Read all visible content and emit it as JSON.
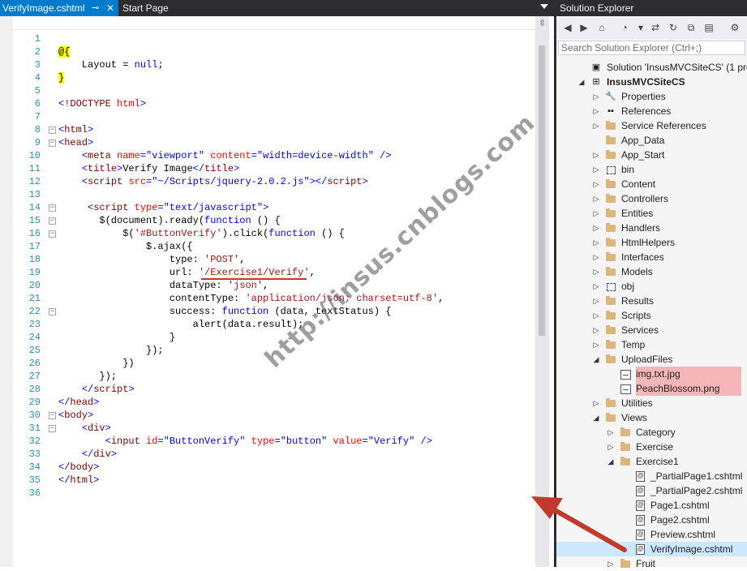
{
  "tabs": {
    "active": "VerifyImage.cshtml",
    "other": "Start Page"
  },
  "editor": {
    "lines": [
      {
        "n": "1",
        "html": ""
      },
      {
        "n": "2",
        "html": "<span class='rz'>@{</span>"
      },
      {
        "n": "3",
        "html": "    Layout = <span class='kw'>null</span>;"
      },
      {
        "n": "4",
        "html": "<span class='rz'>}</span>"
      },
      {
        "n": "5",
        "html": ""
      },
      {
        "n": "6",
        "html": "<span class='kw'>&lt;</span><span class='tg'>!DOCTYPE</span> <span class='at'>html</span><span class='kw'>&gt;</span>"
      },
      {
        "n": "7",
        "html": ""
      },
      {
        "n": "8",
        "html": "<span class='kw'>&lt;</span><span class='tg'>html</span><span class='kw'>&gt;</span>",
        "fold": true
      },
      {
        "n": "9",
        "html": "<span class='kw'>&lt;</span><span class='tg'>head</span><span class='kw'>&gt;</span>",
        "fold": true
      },
      {
        "n": "10",
        "html": "    <span class='kw'>&lt;</span><span class='tg'>meta</span> <span class='at'>name</span><span class='kw'>=</span><span class='kw'>\"viewport\"</span> <span class='at'>content</span><span class='kw'>=</span><span class='kw'>\"width=device-width\"</span> <span class='kw'>/&gt;</span>"
      },
      {
        "n": "11",
        "html": "    <span class='kw'>&lt;</span><span class='tg'>title</span><span class='kw'>&gt;</span>Verify Image<span class='kw'>&lt;/</span><span class='tg'>title</span><span class='kw'>&gt;</span>"
      },
      {
        "n": "12",
        "html": "    <span class='kw'>&lt;</span><span class='tg'>script</span> <span class='at'>src</span><span class='kw'>=</span><span class='kw'>\"~/Scripts/jquery-2.0.2.js\"</span><span class='kw'>&gt;&lt;/</span><span class='tg'>script</span><span class='kw'>&gt;</span>"
      },
      {
        "n": "13",
        "html": ""
      },
      {
        "n": "14",
        "html": "     <span class='kw'>&lt;</span><span class='tg'>script</span> <span class='at'>type</span><span class='kw'>=</span><span class='kw'>\"text/javascript\"</span><span class='kw'>&gt;</span>",
        "fold": true
      },
      {
        "n": "15",
        "html": "       $(document).ready(<span class='kw'>function</span> () {",
        "fold": true
      },
      {
        "n": "16",
        "html": "           $(<span class='st'>'#ButtonVerify'</span>).click(<span class='kw'>function</span> () {",
        "fold": true
      },
      {
        "n": "17",
        "html": "               $.ajax({"
      },
      {
        "n": "18",
        "html": "                   type: <span class='st'>'POST'</span>,"
      },
      {
        "n": "19",
        "html": "                   url: <span class='st'>'/Exercise1/Verify'</span>,"
      },
      {
        "n": "20",
        "html": "                   dataType: <span class='st'>'json'</span>,"
      },
      {
        "n": "21",
        "html": "                   contentType: <span class='st'>'application/json; charset=utf-8'</span>,"
      },
      {
        "n": "22",
        "html": "                   success: <span class='kw'>function</span> (data, textStatus) {",
        "fold": true
      },
      {
        "n": "23",
        "html": "                       alert(data.result);"
      },
      {
        "n": "24",
        "html": "                   }"
      },
      {
        "n": "25",
        "html": "               });"
      },
      {
        "n": "26",
        "html": "           })"
      },
      {
        "n": "27",
        "html": "       });"
      },
      {
        "n": "28",
        "html": "    <span class='kw'>&lt;/</span><span class='tg'>script</span><span class='kw'>&gt;</span>"
      },
      {
        "n": "29",
        "html": "<span class='kw'>&lt;/</span><span class='tg'>head</span><span class='kw'>&gt;</span>"
      },
      {
        "n": "30",
        "html": "<span class='kw'>&lt;</span><span class='tg'>body</span><span class='kw'>&gt;</span>",
        "fold": true
      },
      {
        "n": "31",
        "html": "    <span class='kw'>&lt;</span><span class='tg'>div</span><span class='kw'>&gt;</span>",
        "fold": true
      },
      {
        "n": "32",
        "html": "        <span class='kw'>&lt;</span><span class='tg'>input</span> <span class='at'>id</span><span class='kw'>=</span><span class='kw'>\"ButtonVerify\"</span> <span class='at'>type</span><span class='kw'>=</span><span class='kw'>\"button\"</span> <span class='at'>value</span><span class='kw'>=</span><span class='kw'>\"Verify\"</span> <span class='kw'>/&gt;</span>"
      },
      {
        "n": "33",
        "html": "    <span class='kw'>&lt;/</span><span class='tg'>div</span><span class='kw'>&gt;</span>"
      },
      {
        "n": "34",
        "html": "<span class='kw'>&lt;/</span><span class='tg'>body</span><span class='kw'>&gt;</span>"
      },
      {
        "n": "35",
        "html": "<span class='kw'>&lt;/</span><span class='tg'>html</span><span class='kw'>&gt;</span>"
      },
      {
        "n": "36",
        "html": ""
      }
    ]
  },
  "watermark": "http://insus.cnblogs.com",
  "solution_explorer": {
    "title": "Solution Explorer",
    "search_placeholder": "Search Solution Explorer (Ctrl+;)",
    "nodes": [
      {
        "label": "Solution 'InsusMVCSiteCS' (1 project)",
        "level": 0,
        "icon": "solution-icon",
        "toggle": ""
      },
      {
        "label": "InsusMVCSiteCS",
        "level": 0,
        "icon": "project-icon",
        "toggle": "open",
        "bold": true
      },
      {
        "label": "Properties",
        "level": 1,
        "icon": "wrench-icon",
        "toggle": "closed"
      },
      {
        "label": "References",
        "level": 1,
        "icon": "references-icon",
        "toggle": "closed"
      },
      {
        "label": "Service References",
        "level": 1,
        "icon": "folder-icon",
        "toggle": "closed"
      },
      {
        "label": "App_Data",
        "level": 1,
        "icon": "folder-icon",
        "toggle": ""
      },
      {
        "label": "App_Start",
        "level": 1,
        "icon": "folder-icon",
        "toggle": "closed"
      },
      {
        "label": "bin",
        "level": 1,
        "icon": "dashed-folder-icon",
        "toggle": "closed"
      },
      {
        "label": "Content",
        "level": 1,
        "icon": "folder-icon",
        "toggle": "closed"
      },
      {
        "label": "Controllers",
        "level": 1,
        "icon": "folder-icon",
        "toggle": "closed"
      },
      {
        "label": "Entities",
        "level": 1,
        "icon": "folder-icon",
        "toggle": "closed"
      },
      {
        "label": "Handlers",
        "level": 1,
        "icon": "folder-icon",
        "toggle": "closed"
      },
      {
        "label": "HtmlHelpers",
        "level": 1,
        "icon": "folder-icon",
        "toggle": "closed"
      },
      {
        "label": "Interfaces",
        "level": 1,
        "icon": "folder-icon",
        "toggle": "closed"
      },
      {
        "label": "Models",
        "level": 1,
        "icon": "folder-icon",
        "toggle": "closed"
      },
      {
        "label": "obj",
        "level": 1,
        "icon": "dashed-folder-icon",
        "toggle": "closed"
      },
      {
        "label": "Results",
        "level": 1,
        "icon": "folder-icon",
        "toggle": "closed"
      },
      {
        "label": "Scripts",
        "level": 1,
        "icon": "folder-icon",
        "toggle": "closed"
      },
      {
        "label": "Services",
        "level": 1,
        "icon": "folder-icon",
        "toggle": "closed"
      },
      {
        "label": "Temp",
        "level": 1,
        "icon": "folder-icon",
        "toggle": "closed"
      },
      {
        "label": "UploadFiles",
        "level": 1,
        "icon": "folder-icon",
        "toggle": "open"
      },
      {
        "label": "img.txt.jpg",
        "level": 2,
        "icon": "image-file-icon",
        "toggle": "",
        "highlight": true
      },
      {
        "label": "PeachBlossom.png",
        "level": 2,
        "icon": "image-file-icon",
        "toggle": "",
        "highlight": true
      },
      {
        "label": "Utilities",
        "level": 1,
        "icon": "folder-icon",
        "toggle": "closed"
      },
      {
        "label": "Views",
        "level": 1,
        "icon": "folder-icon",
        "toggle": "open"
      },
      {
        "label": "Category",
        "level": 2,
        "icon": "folder-icon",
        "toggle": "closed"
      },
      {
        "label": "Exercise",
        "level": 2,
        "icon": "folder-icon",
        "toggle": "closed"
      },
      {
        "label": "Exercise1",
        "level": 2,
        "icon": "folder-icon",
        "toggle": "open"
      },
      {
        "label": "_PartialPage1.cshtml",
        "level": 3,
        "icon": "cshtml-file-icon",
        "toggle": ""
      },
      {
        "label": "_PartialPage2.cshtml",
        "level": 3,
        "icon": "cshtml-file-icon",
        "toggle": ""
      },
      {
        "label": "Page1.cshtml",
        "level": 3,
        "icon": "cshtml-file-icon",
        "toggle": ""
      },
      {
        "label": "Page2.cshtml",
        "level": 3,
        "icon": "cshtml-file-icon",
        "toggle": ""
      },
      {
        "label": "Preview.cshtml",
        "level": 3,
        "icon": "cshtml-file-icon",
        "toggle": ""
      },
      {
        "label": "VerifyImage.cshtml",
        "level": 3,
        "icon": "cshtml-file-icon",
        "toggle": "",
        "selected": true
      },
      {
        "label": "Fruit",
        "level": 2,
        "icon": "folder-icon",
        "toggle": "closed"
      }
    ]
  },
  "colors": {
    "active_tab": "#007acc",
    "highlight": "#f4b6b9",
    "selection": "#cce8ff",
    "arrow": "#c0392b"
  }
}
